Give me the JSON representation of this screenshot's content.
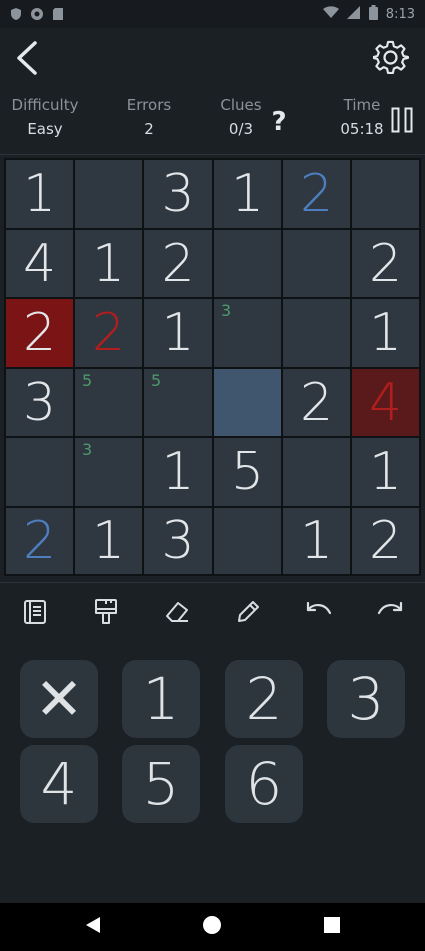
{
  "status_bar": {
    "time": "8:13"
  },
  "info": {
    "difficulty_label": "Difficulty",
    "difficulty_value": "Easy",
    "errors_label": "Errors",
    "errors_value": "2",
    "clues_label": "Clues",
    "clues_value": "0/3",
    "hint_label": "?",
    "time_label": "Time",
    "time_value": "05:18"
  },
  "board": {
    "rows": [
      [
        {
          "v": "1"
        },
        {
          "v": ""
        },
        {
          "v": "3"
        },
        {
          "v": "1"
        },
        {
          "v": "2",
          "style": "blue"
        },
        {
          "v": ""
        }
      ],
      [
        {
          "v": "4"
        },
        {
          "v": "1"
        },
        {
          "v": "2"
        },
        {
          "v": ""
        },
        {
          "v": ""
        },
        {
          "v": "2"
        }
      ],
      [
        {
          "v": "2",
          "state": "error"
        },
        {
          "v": "2",
          "style": "red"
        },
        {
          "v": "1"
        },
        {
          "v": "",
          "note": "3"
        },
        {
          "v": ""
        },
        {
          "v": "1"
        }
      ],
      [
        {
          "v": "3"
        },
        {
          "v": "",
          "note": "5"
        },
        {
          "v": "",
          "note": "5"
        },
        {
          "v": "",
          "state": "selected"
        },
        {
          "v": "2"
        },
        {
          "v": "4",
          "style": "red",
          "state": "error-soft"
        }
      ],
      [
        {
          "v": ""
        },
        {
          "v": "",
          "note": "3"
        },
        {
          "v": "1"
        },
        {
          "v": "5"
        },
        {
          "v": ""
        },
        {
          "v": "1"
        }
      ],
      [
        {
          "v": "2",
          "style": "blue"
        },
        {
          "v": "1"
        },
        {
          "v": "3"
        },
        {
          "v": ""
        },
        {
          "v": "1"
        },
        {
          "v": "2"
        }
      ]
    ]
  },
  "toolbar": {
    "tools": [
      "notes-icon",
      "paint-brush-icon",
      "eraser-icon",
      "pencil-icon",
      "undo-icon",
      "redo-icon"
    ]
  },
  "keypad": {
    "keys": [
      "✕",
      "1",
      "2",
      "3",
      "4",
      "5",
      "6"
    ]
  },
  "colors": {
    "background": "#1b2025",
    "cell": "#2f3740",
    "selected": "#40566e",
    "error": "#7b1414",
    "given_blue": "#4d7fc0",
    "error_text": "#b01e1e",
    "note_green": "#4e9a6a"
  }
}
